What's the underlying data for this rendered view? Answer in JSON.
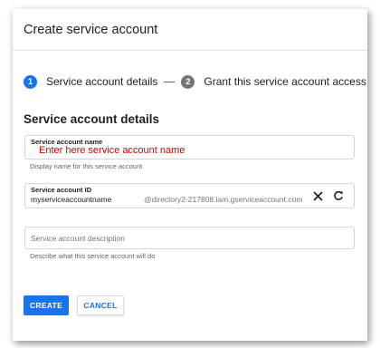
{
  "dialog": {
    "title": "Create service account"
  },
  "stepper": {
    "steps": [
      {
        "number": "1",
        "label": "Service account details"
      },
      {
        "number": "2",
        "label": "Grant this service account access to project"
      }
    ]
  },
  "section": {
    "heading": "Service account details"
  },
  "form": {
    "name": {
      "label": "Service account name",
      "value": "Enter here service account name",
      "helper": "Display name for this service account"
    },
    "id": {
      "label": "Service account ID",
      "value": "myserviceaccountname",
      "suffix": "@directory2-217808.iam.gserviceaccount.com",
      "clear_icon": "close-icon",
      "refresh_icon": "refresh-icon"
    },
    "description": {
      "placeholder": "Service account description",
      "helper": "Describe what this service account will do"
    }
  },
  "actions": {
    "create_label": "CREATE",
    "cancel_label": "CANCEL"
  },
  "colors": {
    "accent": "#1a73e8",
    "error_text": "#d50000",
    "step_inactive": "#757575"
  }
}
